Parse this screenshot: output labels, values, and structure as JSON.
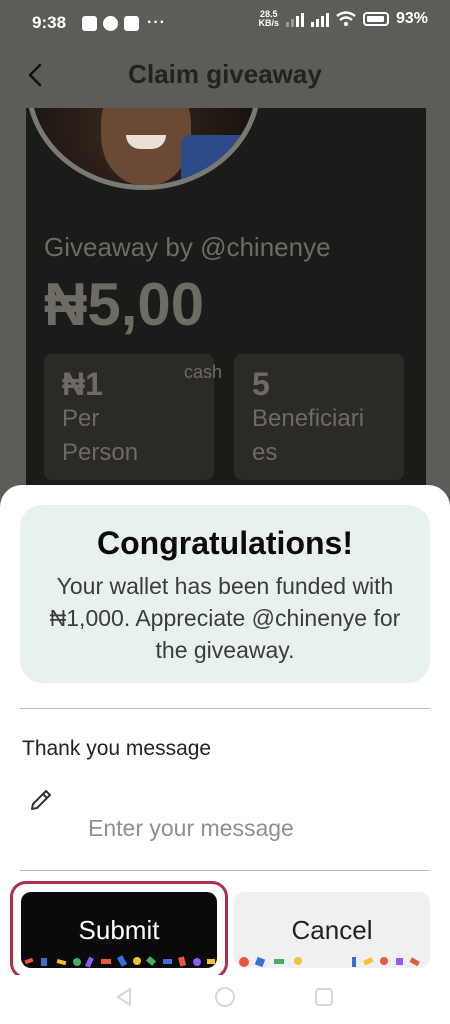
{
  "status_bar": {
    "time": "9:38",
    "net_speed_value": "28.5",
    "net_speed_unit": "KB/s",
    "battery": "93%",
    "notif_more": "···"
  },
  "header": {
    "title": "Claim giveaway"
  },
  "giveaway_card": {
    "by_label": "Giveaway by @chinenye",
    "amount": "₦5,00",
    "cash_label": "cash",
    "per_person_value": "₦1",
    "per_person_label_1": "Per",
    "per_person_label_2": "Person",
    "beneficiaries_value": "5",
    "beneficiaries_label_1": "Beneficiari",
    "beneficiaries_label_2": "es"
  },
  "congrats": {
    "title": "Congratulations!",
    "message": "Your wallet has been funded with ₦1,000. Appreciate @chinenye for the giveaway."
  },
  "thank_you": {
    "label": "Thank you message",
    "placeholder": "Enter your message",
    "value": ""
  },
  "buttons": {
    "submit": "Submit",
    "cancel": "Cancel"
  },
  "colors": {
    "accent": "#0a0a0a",
    "congrats_bg": "#e8f2ec",
    "highlight_ring": "#b0304c"
  }
}
